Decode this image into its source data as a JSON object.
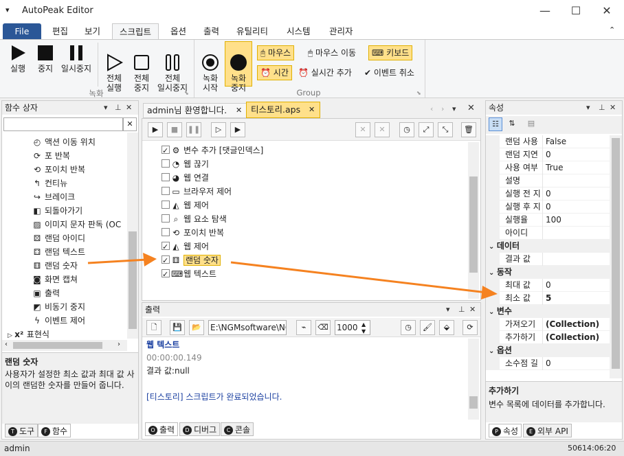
{
  "app": {
    "title": "AutoPeak Editor",
    "menu_icon": "▾"
  },
  "window_controls": {
    "minimize": "—",
    "maximize": "☐",
    "close": "✕"
  },
  "ribbon_tabs": [
    "File",
    "편집",
    "보기",
    "스크립트",
    "옵션",
    "출력",
    "유틸리티",
    "시스템",
    "관리자"
  ],
  "ribbon_collapse": "⌃",
  "record_group": {
    "label": "녹화",
    "buttons": [
      {
        "label": "실행"
      },
      {
        "label": "중지"
      },
      {
        "label": "일시중지"
      },
      {
        "label": "전체\n실행"
      },
      {
        "label": "전체\n중지"
      },
      {
        "label": "전체\n일시중지"
      }
    ]
  },
  "group_group": {
    "label": "Group",
    "rec_start": "녹화\n시작",
    "rec_stop": "녹화\n중지",
    "mouse": "마우스",
    "mouse_move": "마우스 이동",
    "keyboard": "키보드",
    "time": "시간",
    "realtime_add": "실시간 추가",
    "event_cancel": "이벤트 취소"
  },
  "left_panel": {
    "title": "함수 상자",
    "search_value": "",
    "search_clear": "✕",
    "items": [
      {
        "icon": "◴",
        "label": "액션 이동 위치"
      },
      {
        "icon": "⟳",
        "label": "포 반복"
      },
      {
        "icon": "⟲",
        "label": "포이치 반복"
      },
      {
        "icon": "↰",
        "label": "컨티뉴"
      },
      {
        "icon": "↪",
        "label": "브레이크"
      },
      {
        "icon": "◧",
        "label": "되돌아가기"
      },
      {
        "icon": "▨",
        "label": "이미지 문자 판독 (OC"
      },
      {
        "icon": "⚄",
        "label": "랜덤 아이디"
      },
      {
        "icon": "⚃",
        "label": "랜덤 텍스트"
      },
      {
        "icon": "⚅",
        "label": "랜덤 숫자"
      },
      {
        "icon": "◙",
        "label": "화면 캡쳐"
      },
      {
        "icon": "▣",
        "label": "출력"
      },
      {
        "icon": "◩",
        "label": "비동기 중지"
      },
      {
        "icon": "ϟ",
        "label": "이벤트 제어"
      },
      {
        "icon": "x²",
        "label": "표현식"
      }
    ],
    "desc_title": "랜덤 숫자",
    "desc_body": "사용자가 설정한 최소 값과 최대 값 사이의 랜덤한 숫자를 만들어 줍니다.",
    "tabs": [
      {
        "icon": "T",
        "label": "도구"
      },
      {
        "icon": "F",
        "label": "함수"
      }
    ]
  },
  "doc_tabs": [
    {
      "label": "admin님 환영합니다.",
      "close": "✕"
    },
    {
      "label": "티스토리.aps",
      "close": "✕"
    }
  ],
  "script_items": [
    {
      "checked": true,
      "icon": "⚙",
      "label": "변수 추가 [댓글인덱스]"
    },
    {
      "checked": false,
      "icon": "◔",
      "label": "웹 끊기"
    },
    {
      "checked": false,
      "icon": "◕",
      "label": "웹 연결"
    },
    {
      "checked": false,
      "icon": "▭",
      "label": "브라우저 제어"
    },
    {
      "checked": false,
      "icon": "◭",
      "label": "웹 제어"
    },
    {
      "checked": false,
      "icon": "⌕",
      "label": "웹 요소 탐색"
    },
    {
      "checked": false,
      "icon": "⟲",
      "label": "포이치 반복"
    },
    {
      "checked": true,
      "icon": "◭",
      "label": "웹 제어"
    },
    {
      "checked": true,
      "icon": "⚅",
      "label": "랜덤 숫자"
    },
    {
      "checked": true,
      "icon": "⌨",
      "label": "웹 텍스트"
    }
  ],
  "output": {
    "title": "출력",
    "path": "E:\\NGMsoftware\\NG",
    "count": "1000",
    "lines": [
      {
        "text": "웹 텍스트",
        "color": "#1a3fa0",
        "bold": true
      },
      {
        "text": "00:00:00.149",
        "color": "#888888",
        "bold": false
      },
      {
        "text": "결과 값:null",
        "color": "#222222",
        "bold": false
      },
      {
        "text": "",
        "color": "#222222",
        "bold": false
      },
      {
        "text": "[티스토리] 스크립트가 완료되었습니다.",
        "color": "#1a3fa0",
        "bold": false
      }
    ],
    "tabs": [
      {
        "icon": "O",
        "label": "출력"
      },
      {
        "icon": "D",
        "label": "디버그"
      },
      {
        "icon": "C",
        "label": "콘솔"
      }
    ]
  },
  "props": {
    "title": "속성",
    "rows": [
      {
        "type": "prop",
        "name": "랜덤 사용",
        "value": "False"
      },
      {
        "type": "prop",
        "name": "랜덤 지연",
        "value": "0"
      },
      {
        "type": "prop",
        "name": "사용 여부",
        "value": "True"
      },
      {
        "type": "prop",
        "name": "설명",
        "value": ""
      },
      {
        "type": "prop",
        "name": "실행 전 지",
        "value": "0"
      },
      {
        "type": "prop",
        "name": "실행 후 지",
        "value": "0"
      },
      {
        "type": "prop",
        "name": "실행율",
        "value": "100"
      },
      {
        "type": "prop",
        "name": "아이디",
        "value": ""
      },
      {
        "type": "cat",
        "name": "데이터"
      },
      {
        "type": "prop",
        "name": "결과 값",
        "value": ""
      },
      {
        "type": "cat",
        "name": "동작"
      },
      {
        "type": "prop",
        "name": "최대 값",
        "value": "0"
      },
      {
        "type": "prop",
        "name": "최소 값",
        "value": "5",
        "bold": true
      },
      {
        "type": "cat",
        "name": "변수"
      },
      {
        "type": "prop",
        "name": "가져오기",
        "value": "(Collection)",
        "bold": true
      },
      {
        "type": "prop",
        "name": "추가하기",
        "value": "(Collection)",
        "bold": true
      },
      {
        "type": "cat",
        "name": "옵션"
      },
      {
        "type": "prop",
        "name": "소수점 길",
        "value": "0"
      }
    ],
    "desc_title": "추가하기",
    "desc_body": "변수 목록에 데이터를 추가합니다.",
    "tabs": [
      {
        "icon": "P",
        "label": "속성"
      },
      {
        "icon": "E",
        "label": "외부 API"
      }
    ]
  },
  "status": {
    "left": "admin",
    "right": "50614:06:20"
  },
  "colors": {
    "accent": "#2b5797",
    "highlight": "#ffe08a",
    "arrow": "#f58220"
  }
}
